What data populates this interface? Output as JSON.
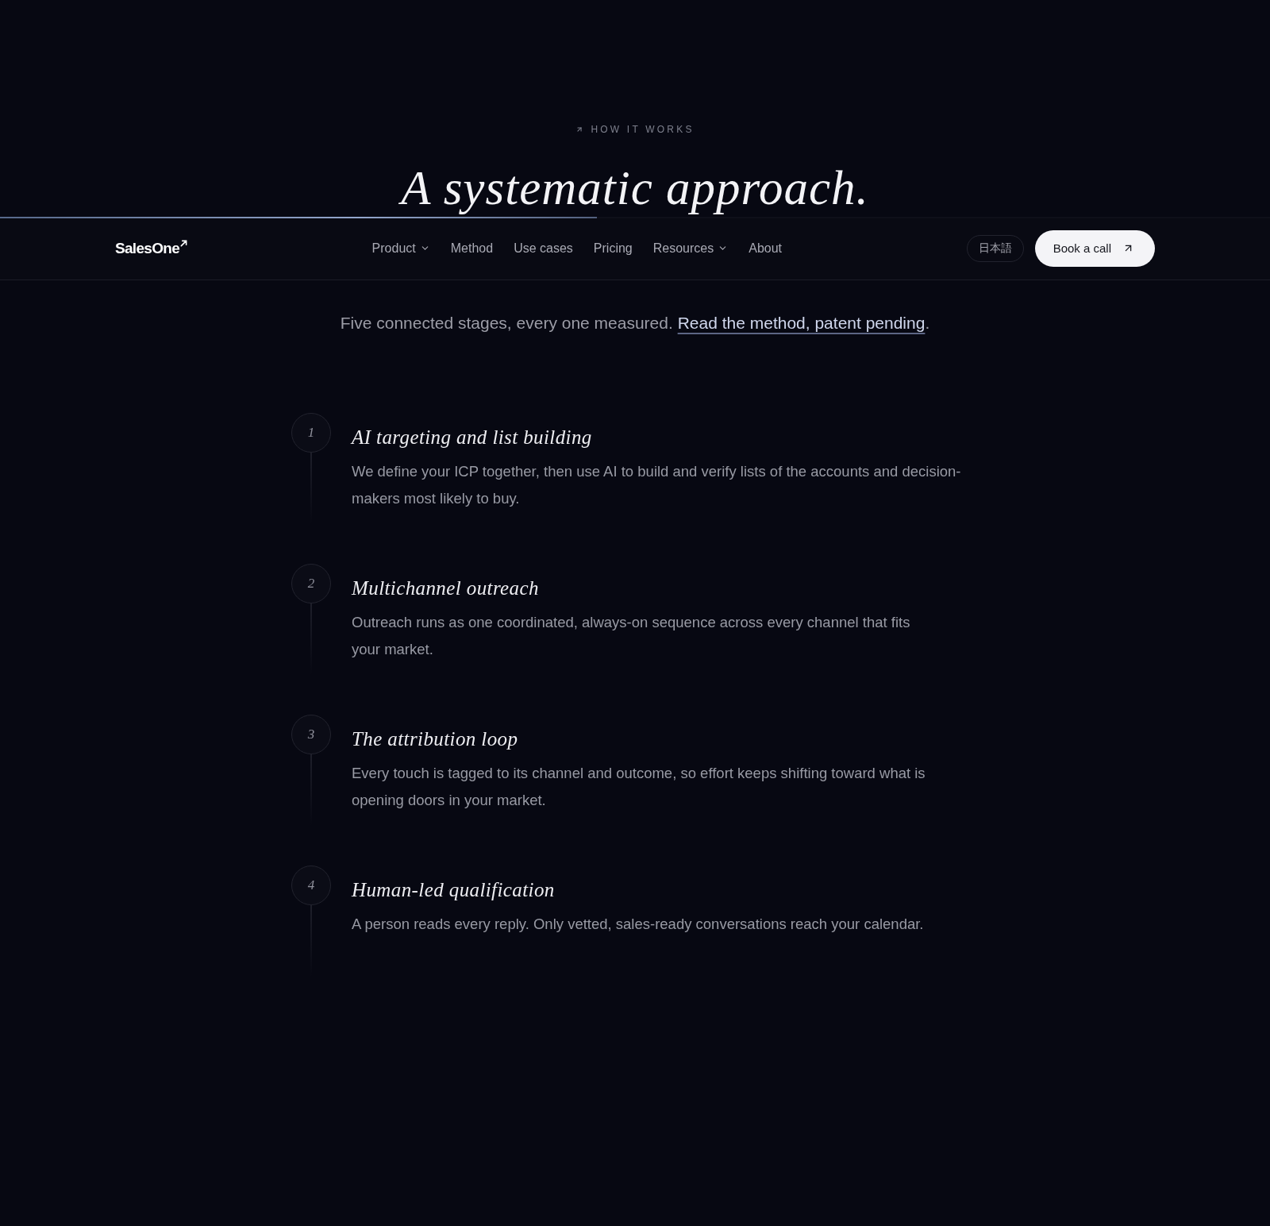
{
  "section": {
    "eyebrow": "HOW IT WORKS",
    "title": "A systematic approach."
  },
  "scroll_progress": {
    "level": 0.47
  },
  "nav": {
    "logo": "SalesOne",
    "links": [
      {
        "label": "Product",
        "dropdown": true
      },
      {
        "label": "Method",
        "dropdown": false
      },
      {
        "label": "Use cases",
        "dropdown": false
      },
      {
        "label": "Pricing",
        "dropdown": false
      },
      {
        "label": "Resources",
        "dropdown": true
      },
      {
        "label": "About",
        "dropdown": false
      }
    ],
    "language": "日本語",
    "cta": "Book a call"
  },
  "intro": {
    "text": "Five connected stages, every one measured.",
    "link": "Read the method, patent pending",
    "end": "."
  },
  "steps": [
    {
      "number": "1",
      "title": "AI targeting and list building",
      "description": "We define your ICP together, then use AI to build and verify lists of the accounts and decision-makers most likely to buy."
    },
    {
      "number": "2",
      "title": "Multichannel outreach",
      "description": "Outreach runs as one coordinated, always-on sequence across every channel that fits your market."
    },
    {
      "number": "3",
      "title": "The attribution loop",
      "description": "Every touch is tagged to its channel and outcome, so effort keeps shifting toward what is opening doors in your market."
    },
    {
      "number": "4",
      "title": "Human-led qualification",
      "description": "A person reads every reply. Only vetted, sales-ready conversations reach your calendar."
    }
  ]
}
